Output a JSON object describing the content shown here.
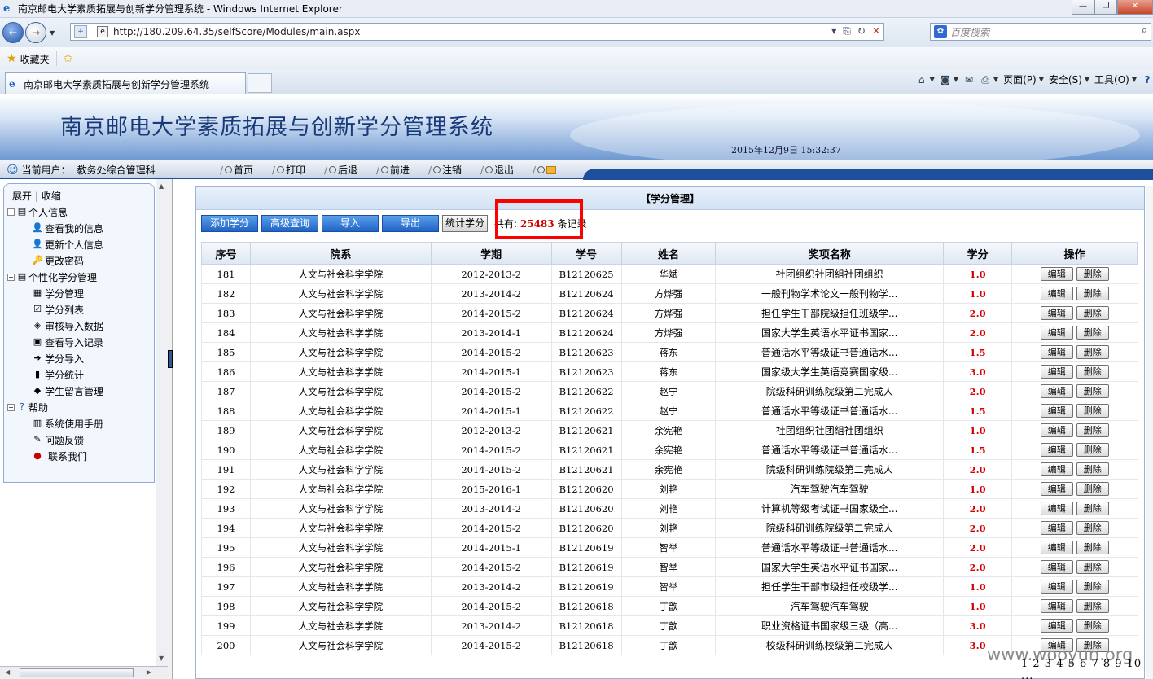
{
  "browser": {
    "window_title": "南京邮电大学素质拓展与创新学分管理系统 - Windows Internet Explorer",
    "url": "http://180.209.64.35/selfScore/Modules/main.aspx",
    "search_placeholder": "百度搜索",
    "favorites_label": "收藏夹",
    "tab_title": "南京邮电大学素质拓展与创新学分管理系统",
    "cmd_page": "页面(P)",
    "cmd_safety": "安全(S)",
    "cmd_tools": "工具(O)"
  },
  "app": {
    "title": "南京邮电大学素质拓展与创新学分管理系统",
    "datetime": "2015年12月9日  15:32:37",
    "user_label": "当前用户：",
    "user_name": "教务处综合管理科",
    "nav": [
      "首页",
      "打印",
      "后退",
      "前进",
      "注销",
      "退出"
    ]
  },
  "sidebar": {
    "expand": "展开",
    "collapse": "收缩",
    "groups": [
      {
        "label": "个人信息",
        "items": [
          "查看我的信息",
          "更新个人信息",
          "更改密码"
        ]
      },
      {
        "label": "个性化学分管理",
        "items": [
          "学分管理",
          "学分列表",
          "审核导入数据",
          "查看导入记录",
          "学分导入",
          "学分统计",
          "学生留言管理"
        ]
      },
      {
        "label": "帮助",
        "items": [
          "系统使用手册",
          "问题反馈",
          "联系我们"
        ]
      }
    ]
  },
  "main": {
    "caption": "【学分管理】",
    "buttons": {
      "add": "添加学分",
      "advanced": "高级查询",
      "import": "导入",
      "export": "导出",
      "stats": "统计学分"
    },
    "total_prefix": "共有:",
    "total_count": "25483",
    "total_suffix": "条记录",
    "columns": [
      "序号",
      "院系",
      "学期",
      "学号",
      "姓名",
      "奖项名称",
      "学分",
      "操作"
    ],
    "edit_label": "编辑",
    "delete_label": "删除",
    "rows": [
      [
        "181",
        "人文与社会科学学院",
        "2012-2013-2",
        "B12120625",
        "华斌",
        "社团组织社团組社团组织",
        "1.0"
      ],
      [
        "182",
        "人文与社会科学学院",
        "2013-2014-2",
        "B12120624",
        "方烨强",
        "一般刊物学术论文一般刊物学...",
        "1.0"
      ],
      [
        "183",
        "人文与社会科学学院",
        "2014-2015-2",
        "B12120624",
        "方烨强",
        "担任学生干部院级担任班级学...",
        "2.0"
      ],
      [
        "184",
        "人文与社会科学学院",
        "2013-2014-1",
        "B12120624",
        "方烨强",
        "国家大学生英语水平证书国家...",
        "2.0"
      ],
      [
        "185",
        "人文与社会科学学院",
        "2014-2015-2",
        "B12120623",
        "蒋东",
        "普通话水平等级证书普通话水...",
        "1.5"
      ],
      [
        "186",
        "人文与社会科学学院",
        "2014-2015-1",
        "B12120623",
        "蒋东",
        "国家级大学生英语竞赛国家级...",
        "3.0"
      ],
      [
        "187",
        "人文与社会科学学院",
        "2014-2015-2",
        "B12120622",
        "赵宁",
        "院级科研训练院级第二完成人",
        "2.0"
      ],
      [
        "188",
        "人文与社会科学学院",
        "2014-2015-1",
        "B12120622",
        "赵宁",
        "普通话水平等级证书普通话水...",
        "1.5"
      ],
      [
        "189",
        "人文与社会科学学院",
        "2012-2013-2",
        "B12120621",
        "余宪艳",
        "社团组织社团組社团组织",
        "1.0"
      ],
      [
        "190",
        "人文与社会科学学院",
        "2014-2015-2",
        "B12120621",
        "余宪艳",
        "普通话水平等级证书普通话水...",
        "1.5"
      ],
      [
        "191",
        "人文与社会科学学院",
        "2014-2015-2",
        "B12120621",
        "余宪艳",
        "院级科研训练院级第二完成人",
        "2.0"
      ],
      [
        "192",
        "人文与社会科学学院",
        "2015-2016-1",
        "B12120620",
        "刘艳",
        "汽车驾驶汽车驾驶",
        "1.0"
      ],
      [
        "193",
        "人文与社会科学学院",
        "2013-2014-2",
        "B12120620",
        "刘艳",
        "计算机等级考试证书国家级全...",
        "2.0"
      ],
      [
        "194",
        "人文与社会科学学院",
        "2014-2015-2",
        "B12120620",
        "刘艳",
        "院级科研训练院级第二完成人",
        "2.0"
      ],
      [
        "195",
        "人文与社会科学学院",
        "2014-2015-1",
        "B12120619",
        "智举",
        "普通话水平等级证书普通话水...",
        "2.0"
      ],
      [
        "196",
        "人文与社会科学学院",
        "2014-2015-2",
        "B12120619",
        "智举",
        "国家大学生英语水平证书国家...",
        "2.0"
      ],
      [
        "197",
        "人文与社会科学学院",
        "2013-2014-2",
        "B12120619",
        "智举",
        "担任学生干部市级担任校级学...",
        "1.0"
      ],
      [
        "198",
        "人文与社会科学学院",
        "2014-2015-2",
        "B12120618",
        "丁歆",
        "汽车驾驶汽车驾驶",
        "1.0"
      ],
      [
        "199",
        "人文与社会科学学院",
        "2013-2014-2",
        "B12120618",
        "丁歆",
        "职业资格证书国家级三级（高...",
        "3.0"
      ],
      [
        "200",
        "人文与社会科学学院",
        "2014-2015-2",
        "B12120618",
        "丁歆",
        "校级科研训练校级第二完成人",
        "3.0"
      ]
    ],
    "pager": "1 2 3 4 5 6 7 8 9 10 ..."
  },
  "watermark": "www.wooyun.org"
}
